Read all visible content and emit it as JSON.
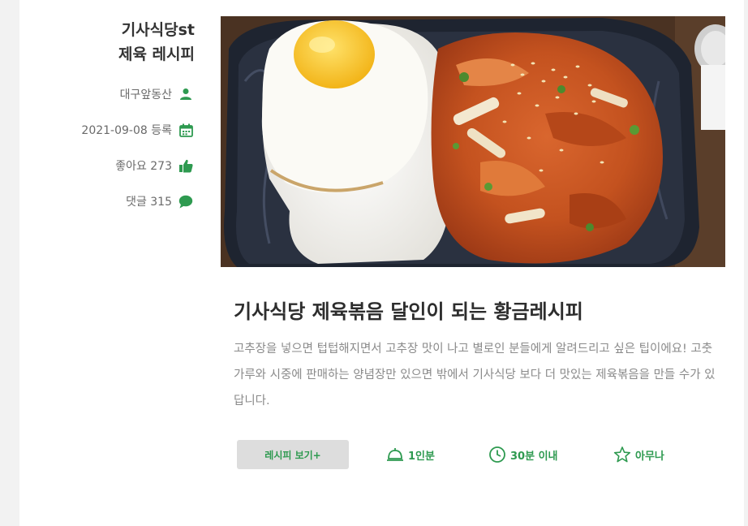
{
  "author_panel": {
    "title_line1": "기사식당st",
    "title_line2": "제육 레시피",
    "author": "대구앞동산",
    "date": "2021-09-08 등록",
    "likes": "좋아요 273",
    "comments": "댓글 315"
  },
  "recipe": {
    "title": "기사식당 제육볶음 달인이 되는 황금레시피",
    "description": "고추장을 넣으면 텁텁해지면서 고추장 맛이 나고 별로인 분들에게 알려드리고 싶은 팁이에요! 고춧가루와 시중에 판매하는 양념장만 있으면 밖에서 기사식당 보다 더 맛있는 제육볶음을 만들 수가 있답니다.",
    "view_button": "레시피 보기+",
    "servings": "1인분",
    "time": "30분 이내",
    "difficulty": "아무나"
  },
  "colors": {
    "accent": "#2e9a50",
    "background": "#f2f2f2"
  },
  "icons": [
    "person-icon",
    "calendar-icon",
    "thumbs-up-icon",
    "chat-bubble-icon",
    "cloche-icon",
    "clock-icon",
    "star-icon"
  ]
}
